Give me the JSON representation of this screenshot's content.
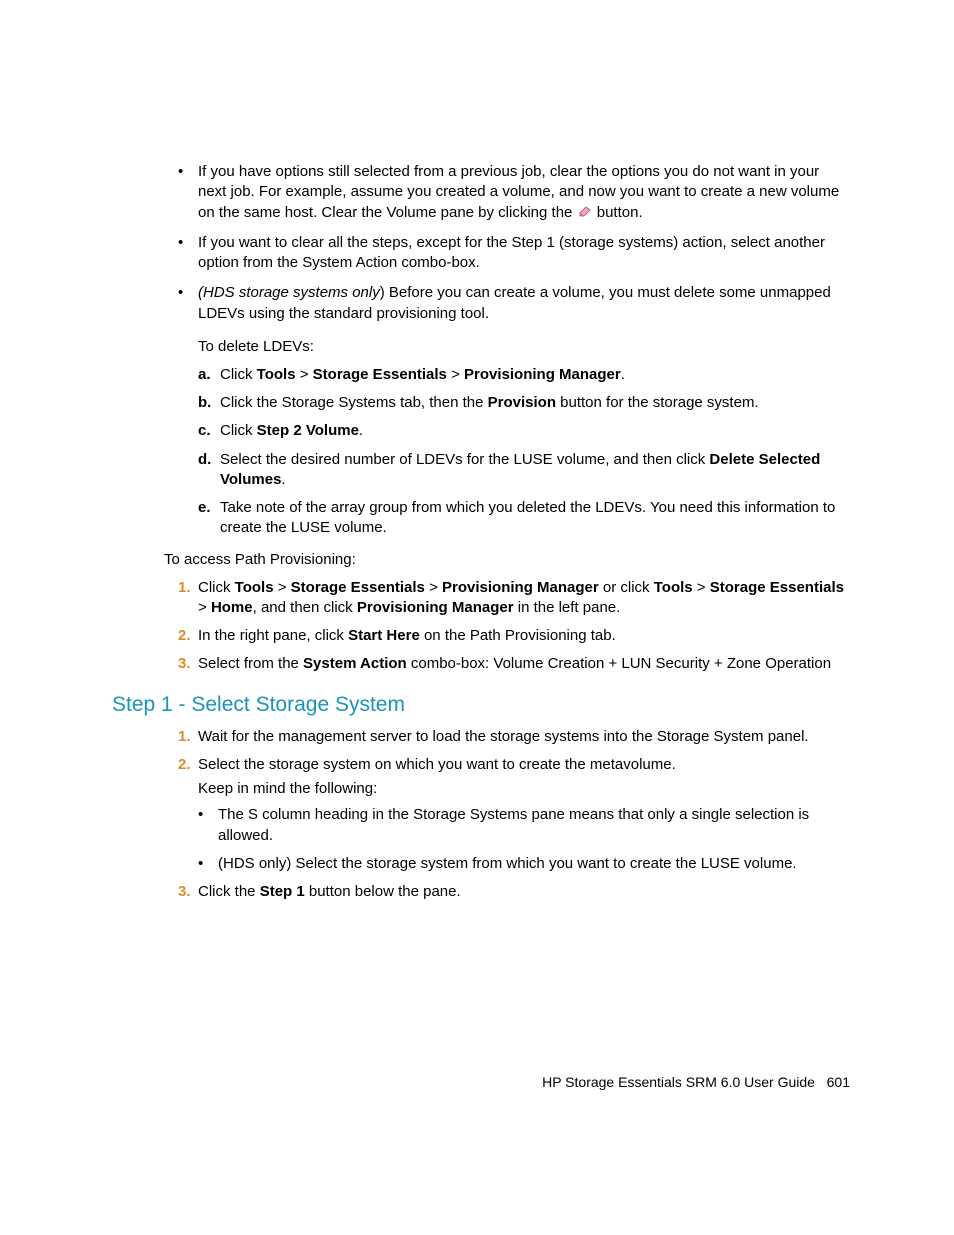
{
  "top_bullets": {
    "b1_part1": "If you have options still selected from a previous job, clear the options you do not want in your next job. For example, assume you created a volume, and now you want to create a new volume on the same host. Clear the Volume pane by clicking the ",
    "b1_part2": " button.",
    "b2": "If you want to clear all the steps, except for the Step 1 (storage systems) action, select another option from the System Action combo-box.",
    "b3_prefix_italic": "(HDS storage systems only",
    "b3_rest": ") Before you can create a volume, you must delete some unmapped LDEVs using the standard provisioning tool."
  },
  "ldev_intro": "To delete LDEVs:",
  "ldev_steps": {
    "a_pre": "Click ",
    "a_b1": "Tools",
    "a_gt1": " > ",
    "a_b2": "Storage Essentials",
    "a_gt2": " > ",
    "a_b3": "Provisioning Manager",
    "a_post": ".",
    "b_pre": "Click the Storage Systems tab, then the ",
    "b_bold": "Provision",
    "b_post": " button for the storage system.",
    "c_pre": "Click ",
    "c_bold": "Step 2 Volume",
    "c_post": ".",
    "d_pre": "Select the desired number of LDEVs for the LUSE volume, and then click ",
    "d_bold": "Delete Selected Volumes",
    "d_post": ".",
    "e": "Take note of the array group from which you deleted the LDEVs. You need this information to create the LUSE volume."
  },
  "access_intro": "To access Path Provisioning:",
  "access_steps": {
    "s1_pre": "Click ",
    "s1_b1": "Tools",
    "s1_g1": " > ",
    "s1_b2": "Storage Essentials",
    "s1_g2": " > ",
    "s1_b3": "Provisioning Manager",
    "s1_mid": " or click ",
    "s1_b4": "Tools",
    "s1_g3": " > ",
    "s1_b5": "Storage Essentials",
    "s1_g4": " > ",
    "s1_b6": "Home",
    "s1_mid2": ", and then click ",
    "s1_b7": "Provisioning Manager",
    "s1_post": " in the left pane.",
    "s2_pre": "In the right pane, click ",
    "s2_bold": "Start Here",
    "s2_post": " on the Path Provisioning tab.",
    "s3_pre": "Select from the ",
    "s3_bold": "System Action",
    "s3_post": " combo-box: Volume Creation + LUN Security + Zone Operation"
  },
  "section_heading": "Step 1 - Select Storage System",
  "section_steps": {
    "s1": "Wait for the management server to load the storage systems into the Storage System panel.",
    "s2_line1": "Select the storage system on which you want to create the metavolume.",
    "s2_line2": "Keep in mind the following:",
    "s2_sub1": "The S column heading in the Storage Systems pane means that only a single selection is allowed.",
    "s2_sub2": "(HDS only) Select the storage system from which you want to create the LUSE volume.",
    "s3_pre": "Click the ",
    "s3_bold": "Step 1",
    "s3_post": " button below the pane."
  },
  "footer": {
    "title": "HP Storage Essentials SRM 6.0 User Guide",
    "page": "601"
  }
}
